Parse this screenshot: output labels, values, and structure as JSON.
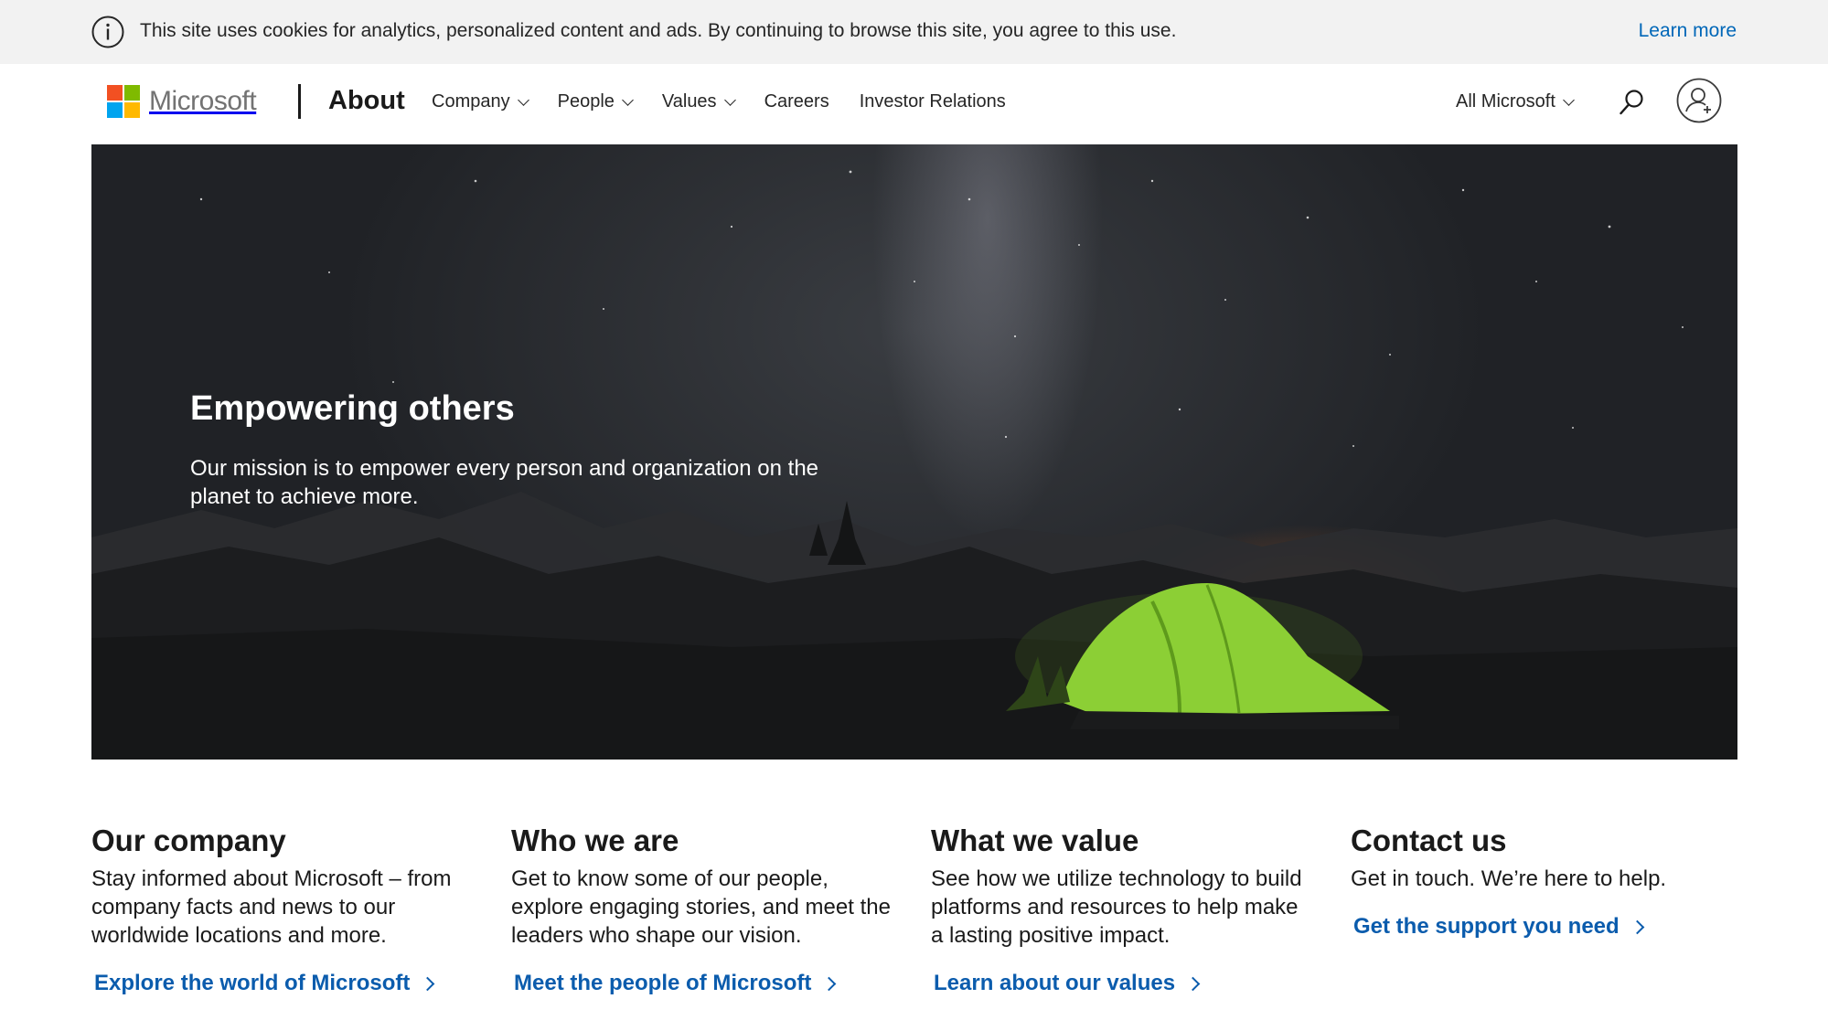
{
  "cookie_banner": {
    "icon": "info-icon",
    "text": "This site uses cookies for analytics, personalized content and ads. By continuing to browse this site, you agree to this use.",
    "learn_more": "Learn more"
  },
  "header": {
    "logo_text": "Microsoft",
    "logo_colors": [
      "#f25022",
      "#7fba00",
      "#00a4ef",
      "#ffb900"
    ],
    "section_title": "About",
    "nav": [
      {
        "label": "Company",
        "has_dropdown": true
      },
      {
        "label": "People",
        "has_dropdown": true
      },
      {
        "label": "Values",
        "has_dropdown": true
      },
      {
        "label": "Careers",
        "has_dropdown": false
      },
      {
        "label": "Investor Relations",
        "has_dropdown": false
      }
    ],
    "all_microsoft": "All Microsoft",
    "search_icon": "search-icon",
    "account_icon": "account-icon"
  },
  "hero": {
    "title": "Empowering others",
    "subtitle": "Our mission is to empower every person and organization on the planet to achieve more."
  },
  "columns": [
    {
      "heading": "Our company",
      "body": "Stay informed about Microsoft – from company facts and news to our worldwide locations and more.",
      "link": "Explore the world of Microsoft"
    },
    {
      "heading": "Who we are",
      "body": "Get to know some of our people, explore engaging stories, and meet the leaders who shape our vision.",
      "link": "Meet the people of Microsoft"
    },
    {
      "heading": "What we value",
      "body": "See how we utilize technology to build platforms and resources to help make a lasting positive impact.",
      "link": "Learn about our values"
    },
    {
      "heading": "Contact us",
      "body": "Get in touch. We’re here to help.",
      "link": "Get the support you need"
    }
  ],
  "colors": {
    "link": "#0b5cad",
    "cookie_link": "#0067b8",
    "cookie_bg": "#f2f2f2"
  }
}
